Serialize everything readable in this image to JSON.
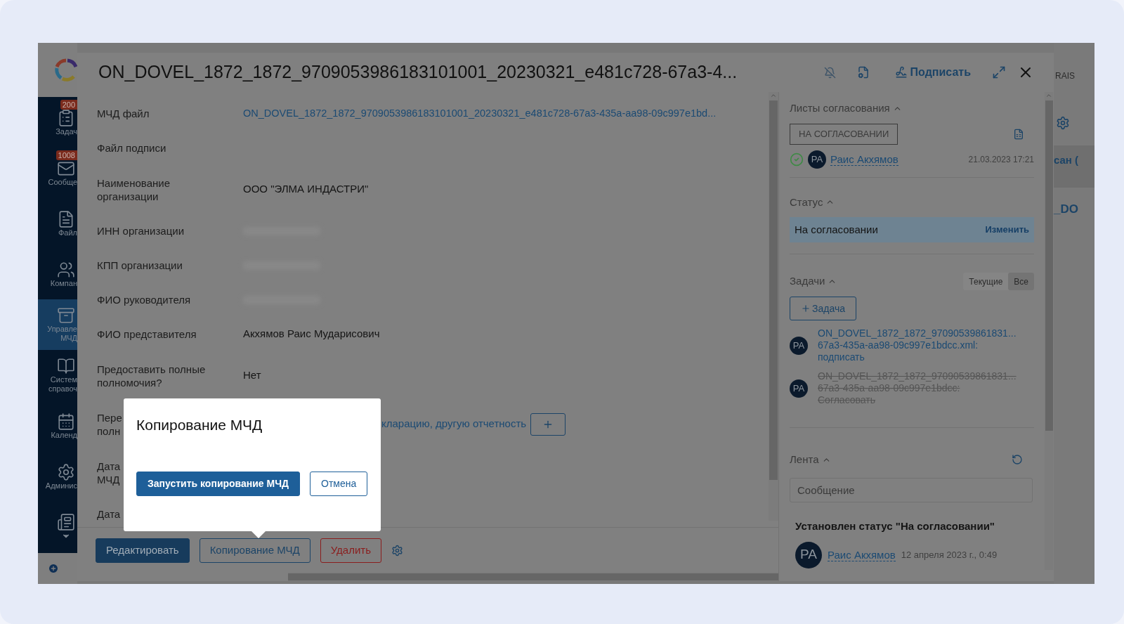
{
  "sidebar": {
    "items": [
      {
        "kind": "tasks",
        "lines": [
          "Задач"
        ],
        "badge": "200",
        "selected": false
      },
      {
        "kind": "messages",
        "lines": [
          "Сообще"
        ],
        "badge": "1008",
        "selected": false
      },
      {
        "kind": "files",
        "lines": [
          "Файл"
        ],
        "selected": false
      },
      {
        "kind": "company",
        "lines": [
          "Компан"
        ],
        "selected": false
      },
      {
        "kind": "mcd",
        "lines": [
          "Управле",
          "МЧД"
        ],
        "selected": true
      },
      {
        "kind": "reference",
        "lines": [
          "Систем",
          "справоч"
        ],
        "selected": false
      },
      {
        "kind": "calendar",
        "lines": [
          "Календ"
        ],
        "selected": false
      },
      {
        "kind": "admin",
        "lines": [
          "Админис"
        ],
        "selected": false
      },
      {
        "kind": "more",
        "selected": false
      }
    ]
  },
  "window": {
    "title": "ON_DOVEL_1872_1872_9709053986183101001_20230321_e481c728-67a3-4...",
    "sign": "Подписать"
  },
  "form": {
    "rows": [
      {
        "label": [
          "МЧД файл"
        ],
        "kind": "link",
        "value": "ON_DOVEL_1872_1872_9709053986183101001_20230321_e481c728-67a3-435a-aa98-09c997e1bd..."
      },
      {
        "label": [
          "Файл подписи"
        ],
        "kind": "empty"
      },
      {
        "label": [
          "Наименование",
          "организации"
        ],
        "kind": "text",
        "value": "ООО \"ЭЛМА ИНДАСТРИ\""
      },
      {
        "label": [
          "ИНН организации"
        ],
        "kind": "redacted"
      },
      {
        "label": [
          "КПП организации"
        ],
        "kind": "redacted"
      },
      {
        "label": [
          "ФИО руководителя"
        ],
        "kind": "redacted"
      },
      {
        "label": [
          "ФИО представителя"
        ],
        "kind": "text",
        "value": "Акхямов Раис Мударисович"
      },
      {
        "label": [
          "Предоставить полные",
          "полномочия?"
        ],
        "kind": "text",
        "value": "Нет"
      },
      {
        "label": [
          "Пере",
          "полн"
        ],
        "kind": "covered_link",
        "value": "кларацию, другую отчетность"
      },
      {
        "label": [
          "Дата",
          "МЧД"
        ],
        "kind": "empty"
      },
      {
        "label": [
          "Дата"
        ],
        "kind": "empty"
      }
    ]
  },
  "footer": {
    "buttons": [
      {
        "label": "Редактировать",
        "kind": "primary"
      },
      {
        "label": "Копирование МЧД",
        "kind": "outline"
      },
      {
        "label": "Удалить",
        "kind": "danger"
      }
    ]
  },
  "dialog": {
    "title": "Копирование МЧД",
    "buttons": [
      {
        "label": "Запустить копирование МЧД",
        "kind": "primary"
      },
      {
        "label": "Отмена",
        "kind": "outline"
      }
    ]
  },
  "approval": {
    "title": "Листы согласования",
    "expanded": true,
    "badge": "НА СОГЛАСОВАНИИ",
    "entries": [
      {
        "avatar": "РА",
        "name": "Раис Акхямов",
        "date": "21.03.2023 17:21",
        "approved": true
      }
    ]
  },
  "status": {
    "title": "Статус",
    "expanded": true,
    "value": "На согласовании",
    "action": "Изменить"
  },
  "tasks": {
    "title": "Задачи",
    "expanded": true,
    "filters": [
      {
        "label": "Текущие",
        "selected": false
      },
      {
        "label": "Все",
        "selected": true
      }
    ],
    "add": "Задача",
    "items": [
      {
        "avatar": "РА",
        "lines": [
          "ON_DOVEL_1872_1872_97090539861831...",
          "67a3-435a-aa98-09c997e1bdcc.xml:",
          "подписать"
        ],
        "done": false
      },
      {
        "avatar": "РА",
        "lines": [
          "ON_DOVEL_1872_1872_97090539861831...",
          "67a3-435a-aa98-09c997e1bdcc:",
          "Согласовать"
        ],
        "done": true
      }
    ]
  },
  "feed": {
    "title": "Лента",
    "expanded": true,
    "placeholder": "Сообщение",
    "events": [
      {
        "text": "Установлен статус \"На согласовании\"",
        "avatar": "РА",
        "name": "Раис Акхямов",
        "date": "12 апреля 2023 г., 0:49"
      }
    ]
  },
  "background": {
    "user": "RAIS",
    "cell_1": "сан (",
    "cell_2": "_DO"
  }
}
